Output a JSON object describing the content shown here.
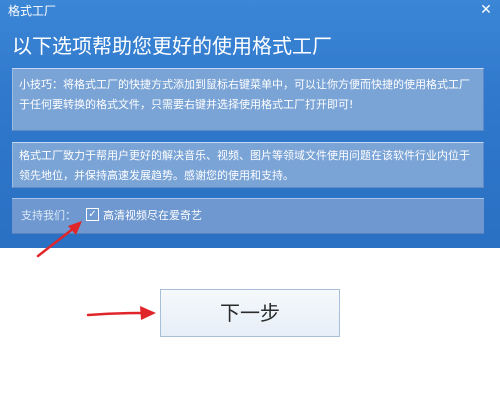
{
  "window": {
    "title": "格式工厂",
    "close_symbol": "✕"
  },
  "heading": "以下选项帮助您更好的使用格式工厂",
  "tip_panel": {
    "text": "小技巧：将格式工厂的快捷方式添加到鼠标右键菜单中，可以让你方便而快捷的使用格式工厂于任何要转换的格式文件，只需要右键并选择使用格式工厂打开即可!"
  },
  "about_panel": {
    "text": "格式工厂致力于帮用户更好的解决音乐、视频、图片等领域文件使用问题在该软件行业内位于领先地位，并保持高速发展趋势。感谢您的使用和支持。"
  },
  "support": {
    "label": "支持我们：",
    "checkbox_mark": "✓",
    "checkbox_checked": true,
    "checkbox_label": "高清视频尽在爱奇艺"
  },
  "next_button": {
    "label": "下一步"
  },
  "colors": {
    "header_blue": "#2f78cc",
    "panel_blue": "#7aa3d6",
    "arrow_red": "#e0262a"
  }
}
